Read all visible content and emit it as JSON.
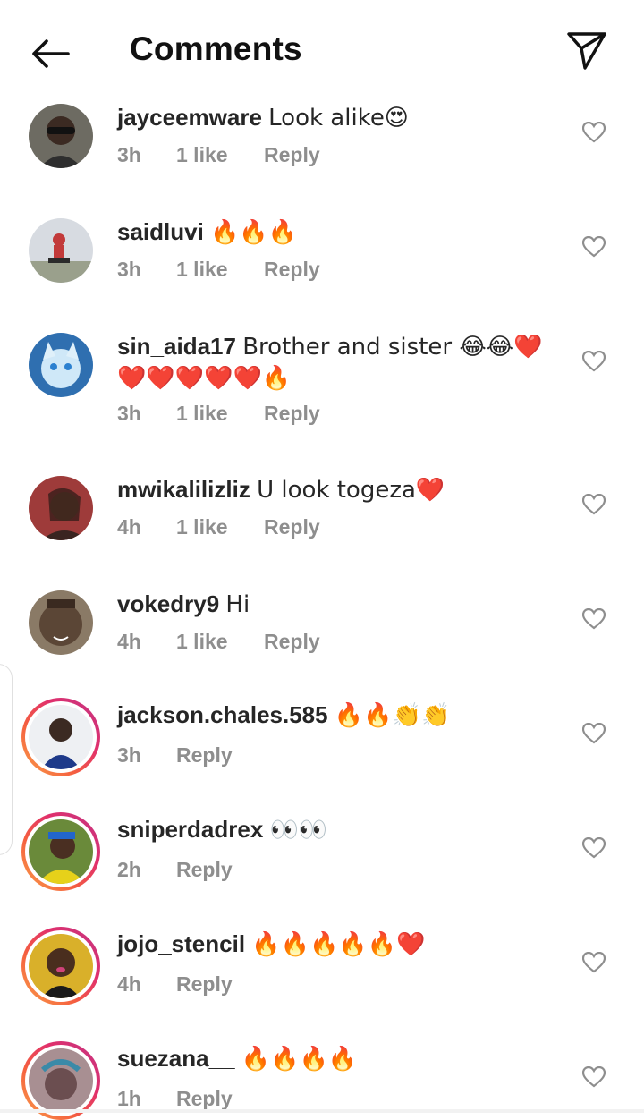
{
  "header": {
    "title": "Comments",
    "back_icon": "back-arrow-icon",
    "send_icon": "paper-plane-icon"
  },
  "colors": {
    "meta_text": "#8e8e8e",
    "story_ring_start": "#f9a04a",
    "story_ring_end": "#c13584",
    "heart_outline": "#8e8e8e"
  },
  "comments": [
    {
      "username": "jayceemware",
      "text": "Look alike😍",
      "text2": "",
      "time": "3h",
      "likes": "1 like",
      "reply": "Reply",
      "avatar_bg": "#6d6b62",
      "story_ring": false
    },
    {
      "username": "saidluvi",
      "text": "🔥🔥🔥",
      "text2": "",
      "time": "3h",
      "likes": "1 like",
      "reply": "Reply",
      "avatar_bg": "#b9bcc2",
      "story_ring": false
    },
    {
      "username": "sin_aida17",
      "text": "Brother and sister 😂😂❤️",
      "text2": "❤️❤️❤️❤️❤️🔥",
      "time": "3h",
      "likes": "1 like",
      "reply": "Reply",
      "avatar_bg": "#4a8fc9",
      "story_ring": false
    },
    {
      "username": "mwikalilizliz",
      "text": "U look togeza❤️",
      "text2": "",
      "time": "4h",
      "likes": "1 like",
      "reply": "Reply",
      "avatar_bg": "#9e3b3a",
      "story_ring": false
    },
    {
      "username": "vokedry9",
      "text": "Hi",
      "text2": "",
      "time": "4h",
      "likes": "1 like",
      "reply": "Reply",
      "avatar_bg": "#5b4636",
      "story_ring": false
    },
    {
      "username": "jackson.chales.585",
      "text": "🔥🔥👏👏",
      "text2": "",
      "time": "3h",
      "likes": "",
      "reply": "Reply",
      "avatar_bg": "#d8dbe0",
      "story_ring": true
    },
    {
      "username": "sniperdadrex",
      "text": "👀👀",
      "text2": "",
      "time": "2h",
      "likes": "",
      "reply": "Reply",
      "avatar_bg": "#6a8a3a",
      "story_ring": true
    },
    {
      "username": "jojo_stencil",
      "text": "🔥🔥🔥🔥🔥❤️",
      "text2": "",
      "time": "4h",
      "likes": "",
      "reply": "Reply",
      "avatar_bg": "#7a5a2a",
      "story_ring": true
    },
    {
      "username": "suezana__",
      "text": "🔥🔥🔥🔥",
      "text2": "",
      "time": "1h",
      "likes": "",
      "reply": "Reply",
      "avatar_bg": "#a88f92",
      "story_ring": true
    }
  ]
}
